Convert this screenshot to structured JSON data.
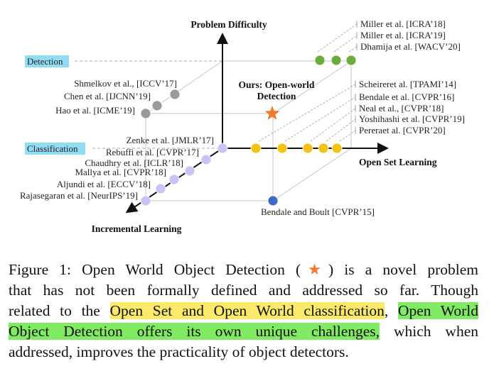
{
  "figure": {
    "axes": {
      "vertical": "Problem Difficulty",
      "horizontal": "Open Set Learning",
      "diagonal": "Incremental Learning"
    },
    "levels": {
      "detection": "Detection",
      "classification": "Classification"
    },
    "ours": [
      "Ours: Open-world",
      "Detection"
    ],
    "incremental_works": [
      "Zenke et al. [JMLR’17]",
      "Rebuffi et al. [CVPR’17]",
      "Chaudhry et al. [ICLR’18]",
      "Mallya et al. [CVPR’18]",
      "Aljundi et al. [ECCV’18]",
      "Rajasegaran et al. [NeurIPS’19]"
    ],
    "incremental_detection_works": [
      "Shmelkov et al., [ICCV’17]",
      "Chen et al. [IJCNN’19]",
      "Hao et al. [ICME’19]"
    ],
    "open_set_detection_works": [
      "Miller et al. [ICRA’18]",
      "Miller et al. [ICRA’19]",
      "Dhamija et al. [WACV’20]"
    ],
    "open_set_works": [
      "Scheireret al. [TPAMI’14]",
      "Bendale et al. [CVPR’16]",
      "Neal et al., [CVPR’18]",
      "Yoshihashi et al. [CVPR’19]",
      "Pereraet al. [CVPR’20]"
    ],
    "open_world_classification": "Bendale and Boult [CVPR’15]",
    "colors": {
      "incremental": "#c9c3f7",
      "incremental_detection": "#9a9a9a",
      "open_set_detection": "#6aad3e",
      "open_set": "#f5c112",
      "open_world": "#3d6cc4",
      "star": "#f07a30",
      "label_highlight": "#8fdcf3"
    }
  },
  "caption": {
    "line1_pre": "Figure 1: Open World Object Detection (",
    "star": "★",
    "line1_post": ") is a novel problem",
    "line2": "that has not been formally defined and addressed so far. Though",
    "line3_pre": "related to the ",
    "highlight_yellow": "Open Set and Open World classification",
    "line3_comma": ", ",
    "highlight_green_1": "Open World",
    "highlight_green_2": "Object Detection offers its own unique challenges,",
    "line4_post": " which when",
    "line5": "addressed, improves the practicality of object detectors."
  }
}
